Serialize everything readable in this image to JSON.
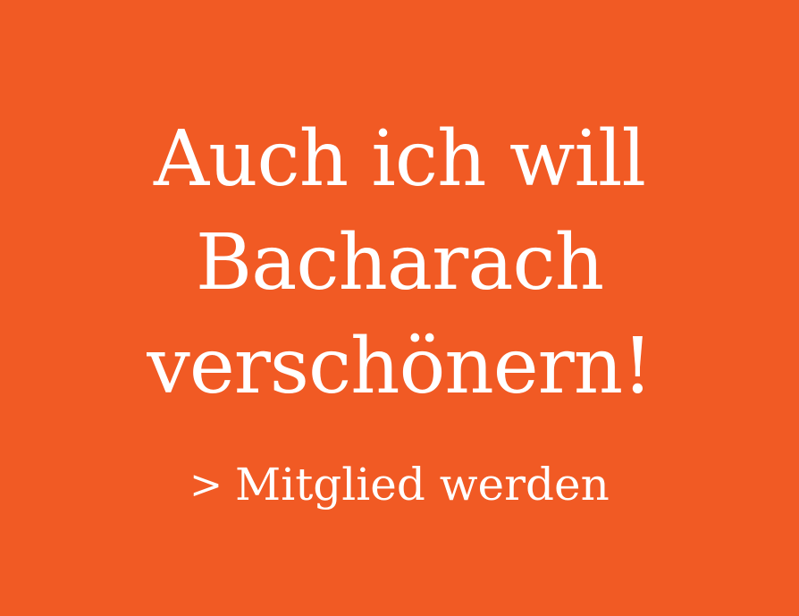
{
  "colors": {
    "background": "#f15a24",
    "text": "#ffffff"
  },
  "headline": {
    "line1": "Auch ich will",
    "line2": "Bacharach",
    "line3": "verschönern!"
  },
  "cta": {
    "prefix": ">",
    "label": "Mitglied werden"
  }
}
